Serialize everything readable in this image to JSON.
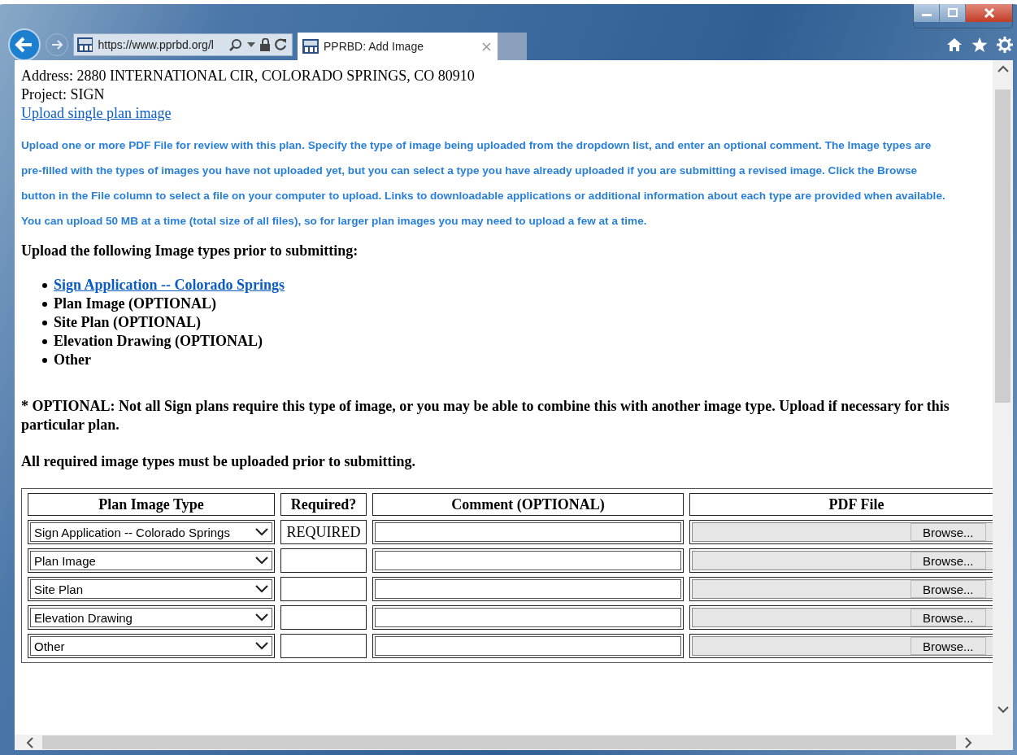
{
  "browser": {
    "address": "https://www.pprbd.org/l",
    "tabs": [
      {
        "label": "PPRBD: Add Image",
        "selected": true
      }
    ]
  },
  "page": {
    "address_line": "Address: 2880 INTERNATIONAL CIR, COLORADO SPRINGS, CO 80910",
    "project_line": "Project: SIGN",
    "upload_link": "Upload single plan image",
    "instructions": "Upload one or more PDF File for review with this plan. Specify the type of image being uploaded from the dropdown list, and enter an optional comment. The Image types are pre-filled with the types of images you have not uploaded yet, but you can select a type you have already uploaded if you are submitting a revised image. Click the Browse button in the File column to select a file on your computer to upload. Links to downloadable applications or additional information about each type are provided when available. You can upload 50 MB at a time (total size of all files), so for larger plan images you may need to upload a few at a time.",
    "required_heading": "Upload the following Image types prior to submitting:",
    "image_types": [
      {
        "label": "Sign Application -- Colorado Springs",
        "kind": "link"
      },
      {
        "label": "Plan Image (OPTIONAL)",
        "kind": "text"
      },
      {
        "label": "Site Plan (OPTIONAL)",
        "kind": "text"
      },
      {
        "label": "Elevation Drawing (OPTIONAL)",
        "kind": "text"
      },
      {
        "label": "Other",
        "kind": "text"
      }
    ],
    "optional_note": "* OPTIONAL: Not all Sign plans require this type of image, or you may be able to combine this with another image type. Upload if necessary for this particular plan.",
    "all_required_note": "All required image types must be uploaded prior to submitting."
  },
  "table": {
    "columns": [
      "Plan Image Type",
      "Required?",
      "Comment (OPTIONAL)",
      "PDF File"
    ],
    "rows": [
      {
        "type": "Sign Application -- Colorado Springs",
        "required": "REQUIRED",
        "browse": "Browse..."
      },
      {
        "type": "Plan Image",
        "browse": "Browse..."
      },
      {
        "type": "Site Plan",
        "browse": "Browse..."
      },
      {
        "type": "Elevation Drawing",
        "browse": "Browse..."
      },
      {
        "type": "Other",
        "browse": "Browse..."
      }
    ]
  }
}
